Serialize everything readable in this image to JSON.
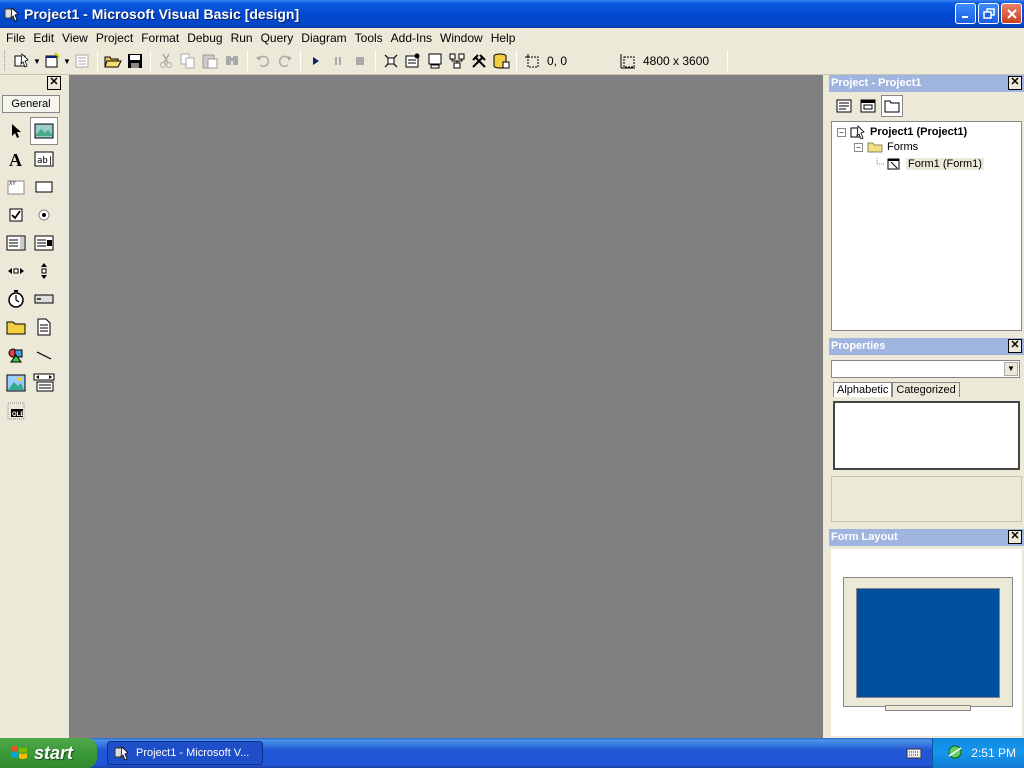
{
  "window": {
    "title": "Project1 - Microsoft Visual Basic [design]",
    "buttons": {
      "minimize": "_",
      "maximize": "□",
      "close": "✕"
    }
  },
  "menu": [
    {
      "label": "File"
    },
    {
      "label": "Edit"
    },
    {
      "label": "View"
    },
    {
      "label": "Project"
    },
    {
      "label": "Format"
    },
    {
      "label": "Debug"
    },
    {
      "label": "Run"
    },
    {
      "label": "Query"
    },
    {
      "label": "Diagram"
    },
    {
      "label": "Tools"
    },
    {
      "label": "Add-Ins"
    },
    {
      "label": "Window"
    },
    {
      "label": "Help"
    }
  ],
  "toolbar": {
    "position": "0, 0",
    "size": "4800 x 3600"
  },
  "toolbox": {
    "tab_label": "General",
    "close": "✕"
  },
  "project_explorer": {
    "title": "Project - Project1",
    "close": "✕",
    "tree": {
      "project": "Project1 (Project1)",
      "folder": "Forms",
      "form": "Form1 (Form1)"
    }
  },
  "properties": {
    "title": "Properties",
    "close": "✕",
    "tabs": [
      "Alphabetic",
      "Categorized"
    ]
  },
  "form_layout": {
    "title": "Form Layout",
    "close": "✕"
  },
  "taskbar": {
    "start_label": "start",
    "task_label": "Project1 - Microsoft V...",
    "clock": "2:51 PM"
  },
  "colors": {
    "title_bar": "#0348d0",
    "workspace": "#808080",
    "pane_title": "#a0b4e0",
    "form_layout_screen": "#0050a0",
    "start_button": "#3c9a3a"
  }
}
